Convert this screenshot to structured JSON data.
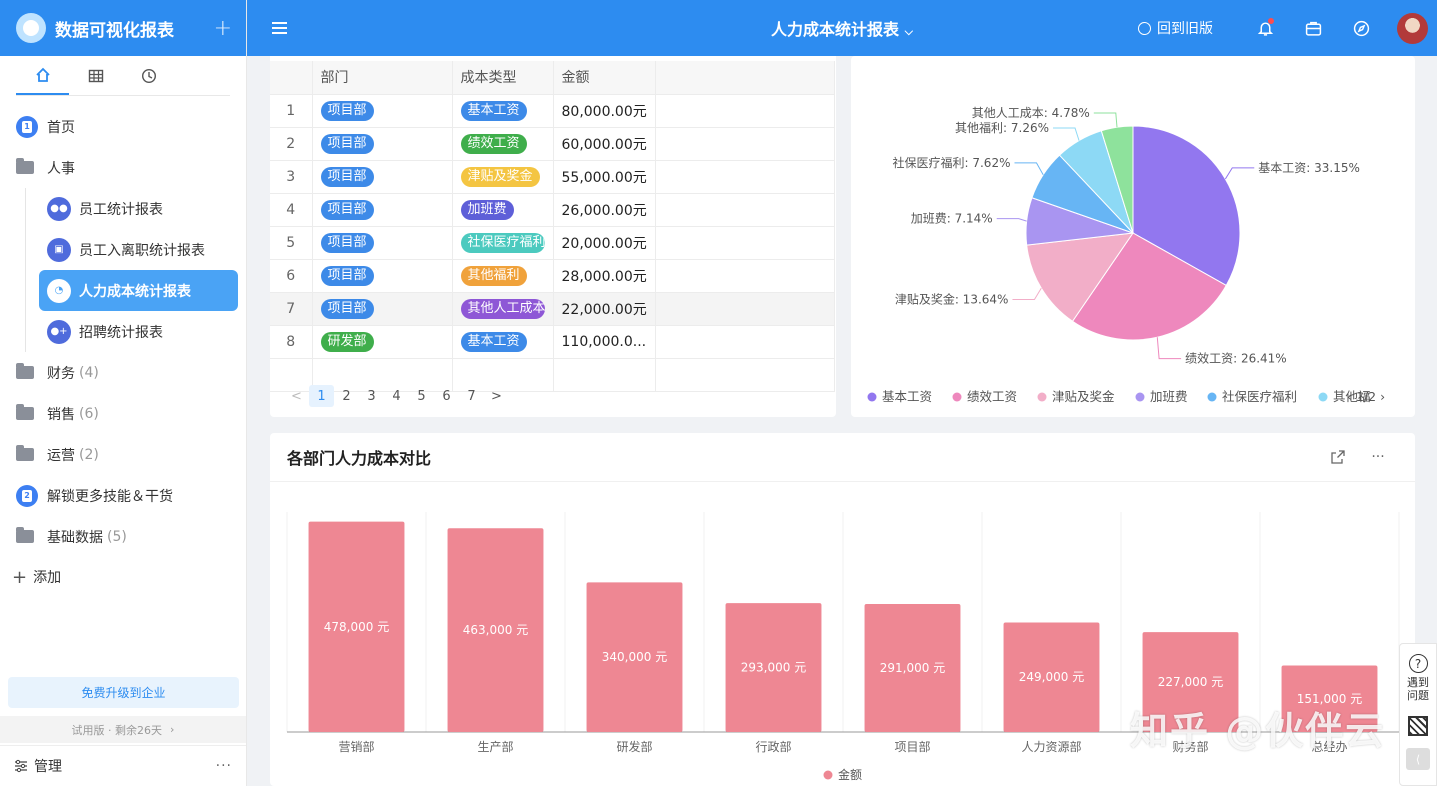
{
  "app": {
    "title": "数据可视化报表",
    "add_label": "+"
  },
  "sidebar": {
    "tabs": [
      {
        "icon": "home-icon"
      },
      {
        "icon": "table-icon"
      },
      {
        "icon": "clock-icon"
      }
    ],
    "items": [
      {
        "label": "首页",
        "type": "badge",
        "badge": "1"
      },
      {
        "label": "人事",
        "type": "folder-open"
      },
      {
        "label": "财务",
        "type": "folder",
        "count": "(4)"
      },
      {
        "label": "销售",
        "type": "folder",
        "count": "(6)"
      },
      {
        "label": "运营",
        "type": "folder",
        "count": "(2)"
      },
      {
        "label": "解锁更多技能＆干货",
        "type": "badge",
        "badge": "2"
      },
      {
        "label": "基础数据",
        "type": "folder",
        "count": "(5)"
      }
    ],
    "sub_items": [
      {
        "label": "员工统计报表"
      },
      {
        "label": "员工入离职统计报表"
      },
      {
        "label": "人力成本统计报表",
        "active": true
      },
      {
        "label": "招聘统计报表"
      }
    ],
    "add_label": "添加",
    "upgrade_label": "免费升级到企业",
    "trial_label": "试用版 · 剩余26天",
    "manage_label": "管理",
    "manage_more": "···"
  },
  "header": {
    "title": "人力成本统计报表",
    "back_label": "回到旧版"
  },
  "table": {
    "columns": [
      "",
      "部门",
      "成本类型",
      "金额"
    ],
    "rows": [
      {
        "idx": "1",
        "dept": "项目部",
        "dept_color": "#3d8ae8",
        "type": "基本工资",
        "type_color": "#3d8ae8",
        "amount": "80,000.00元"
      },
      {
        "idx": "2",
        "dept": "项目部",
        "dept_color": "#3d8ae8",
        "type": "绩效工资",
        "type_color": "#3fae4b",
        "amount": "60,000.00元"
      },
      {
        "idx": "3",
        "dept": "项目部",
        "dept_color": "#3d8ae8",
        "type": "津贴及奖金",
        "type_color": "#f4c542",
        "amount": "55,000.00元"
      },
      {
        "idx": "4",
        "dept": "项目部",
        "dept_color": "#3d8ae8",
        "type": "加班费",
        "type_color": "#5e5fd8",
        "amount": "26,000.00元"
      },
      {
        "idx": "5",
        "dept": "项目部",
        "dept_color": "#3d8ae8",
        "type": "社保医疗福利",
        "type_color": "#4ccabf",
        "amount": "20,000.00元"
      },
      {
        "idx": "6",
        "dept": "项目部",
        "dept_color": "#3d8ae8",
        "type": "其他福利",
        "type_color": "#f0a23b",
        "amount": "28,000.00元"
      },
      {
        "idx": "7",
        "dept": "项目部",
        "dept_color": "#3d8ae8",
        "type": "其他人工成本",
        "type_color": "#8e57d6",
        "amount": "22,000.00元"
      },
      {
        "idx": "8",
        "dept": "研发部",
        "dept_color": "#3fae4b",
        "type": "基本工资",
        "type_color": "#3d8ae8",
        "amount": "110,000.0..."
      }
    ],
    "pager": {
      "prev": "<",
      "pages": [
        "1",
        "2",
        "3",
        "4",
        "5",
        "6",
        "7"
      ],
      "current": "1",
      "next": ">"
    }
  },
  "chart_data": [
    {
      "type": "pie",
      "slices": [
        {
          "name": "基本工资",
          "value": 33.15,
          "label": "基本工资: 33.15%",
          "color": "#9277ef"
        },
        {
          "name": "绩效工资",
          "value": 26.41,
          "label": "绩效工资: 26.41%",
          "color": "#ee88bd"
        },
        {
          "name": "津贴及奖金",
          "value": 13.64,
          "label": "津贴及奖金: 13.64%",
          "color": "#f2aec8"
        },
        {
          "name": "加班费",
          "value": 7.14,
          "label": "加班费: 7.14%",
          "color": "#a995f1"
        },
        {
          "name": "社保医疗福利",
          "value": 7.62,
          "label": "社保医疗福利: 7.62%",
          "color": "#67b5f4"
        },
        {
          "name": "其他福利",
          "value": 7.26,
          "label": "其他福利: 7.26%",
          "color": "#8dd9f5"
        },
        {
          "name": "其他人工成本",
          "value": 4.78,
          "label": "其他人工成本: 4.78%",
          "color": "#8ee29c"
        }
      ],
      "legend": [
        "基本工资",
        "绩效工资",
        "津贴及奖金",
        "加班费",
        "社保医疗福利",
        "其他福"
      ],
      "legend_page": "1/2",
      "legend_placement": "bottom"
    },
    {
      "type": "bar",
      "title": "各部门人力成本对比",
      "categories": [
        "营销部",
        "生产部",
        "研发部",
        "行政部",
        "项目部",
        "人力资源部",
        "财务部",
        "总经办"
      ],
      "series": [
        {
          "name": "金额",
          "values": [
            478000,
            463000,
            340000,
            293000,
            291000,
            249000,
            227000,
            151000
          ],
          "color": "#ee8793"
        }
      ],
      "data_labels": [
        "478,000 元",
        "463,000 元",
        "340,000 元",
        "293,000 元",
        "291,000 元",
        "249,000 元",
        "227,000 元",
        "151,000 元"
      ],
      "ylim": [
        0,
        500000
      ],
      "legend_placement": "bottom",
      "grid": true
    }
  ],
  "float": {
    "help_label_1": "遇到",
    "help_label_2": "问题",
    "q_mark": "?",
    "collapse": "⟨"
  },
  "watermark": "知乎 @伙伴云"
}
